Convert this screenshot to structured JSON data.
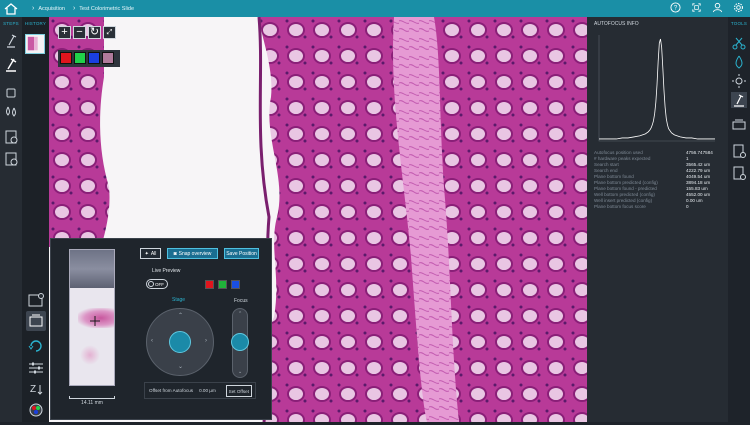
{
  "header": {
    "breadcrumbs": [
      "Acquisition",
      "Test Colorimetric Slide"
    ]
  },
  "left": {
    "steps_label": "STEPS",
    "history_label": "HISTORY"
  },
  "right": {
    "tools_label": "TOOLS"
  },
  "viewer": {
    "channel_colors": [
      "#e0151d",
      "#20d04a",
      "#1a3fe0",
      "#b07a9b"
    ]
  },
  "overview": {
    "scale_value": "14.11",
    "scale_unit": "mm"
  },
  "controls": {
    "all_label": "All",
    "snap_label": "Snap overview",
    "save_label": "Save Position",
    "live_preview_label": "Live Preview",
    "toggle_label": "OFF",
    "live_channels": [
      "#e0151d",
      "#20b43a",
      "#1a4fe0"
    ],
    "stage_label": "Stage",
    "focus_label": "Focus",
    "offset_label": "Offset from Autofocus",
    "offset_value": "0.00 µm",
    "set_offset_label": "Set Offset"
  },
  "autofocus": {
    "title": "AUTOFOCUS INFO",
    "rows": [
      {
        "k": "Autofocus position used",
        "v": "4756.747584"
      },
      {
        "k": "# hardware peaks expected",
        "v": "1"
      },
      {
        "k": "Search start",
        "v": "3565.42 um"
      },
      {
        "k": "Search end",
        "v": "4222.79 um"
      },
      {
        "k": "Plane bottom found",
        "v": "4049.54 um"
      },
      {
        "k": "Plane bottom predicted (config)",
        "v": "3894.18 um"
      },
      {
        "k": "Plane bottom found - predicted",
        "v": "155.83 um"
      },
      {
        "k": "Well bottom predicted (config)",
        "v": "4552.00 um"
      },
      {
        "k": "Well insert predicted (config)",
        "v": "0.00 um"
      },
      {
        "k": "Plane bottom focus score",
        "v": "0"
      }
    ],
    "curve": {
      "type": "line",
      "x": [
        0,
        10,
        20,
        30,
        40,
        50,
        60,
        70,
        75,
        80,
        85,
        88,
        90,
        92,
        94,
        96,
        98,
        100,
        102,
        104,
        106,
        108,
        110,
        112,
        114,
        116,
        118,
        120,
        125,
        130,
        135,
        140,
        150,
        160,
        170,
        180,
        190,
        200
      ],
      "y": [
        0.02,
        0.02,
        0.02,
        0.02,
        0.03,
        0.03,
        0.04,
        0.05,
        0.06,
        0.07,
        0.09,
        0.11,
        0.13,
        0.16,
        0.2,
        0.27,
        0.38,
        0.55,
        0.78,
        0.96,
        1.0,
        0.92,
        0.72,
        0.5,
        0.33,
        0.22,
        0.16,
        0.12,
        0.08,
        0.06,
        0.05,
        0.04,
        0.03,
        0.03,
        0.02,
        0.02,
        0.02,
        0.02
      ]
    }
  }
}
